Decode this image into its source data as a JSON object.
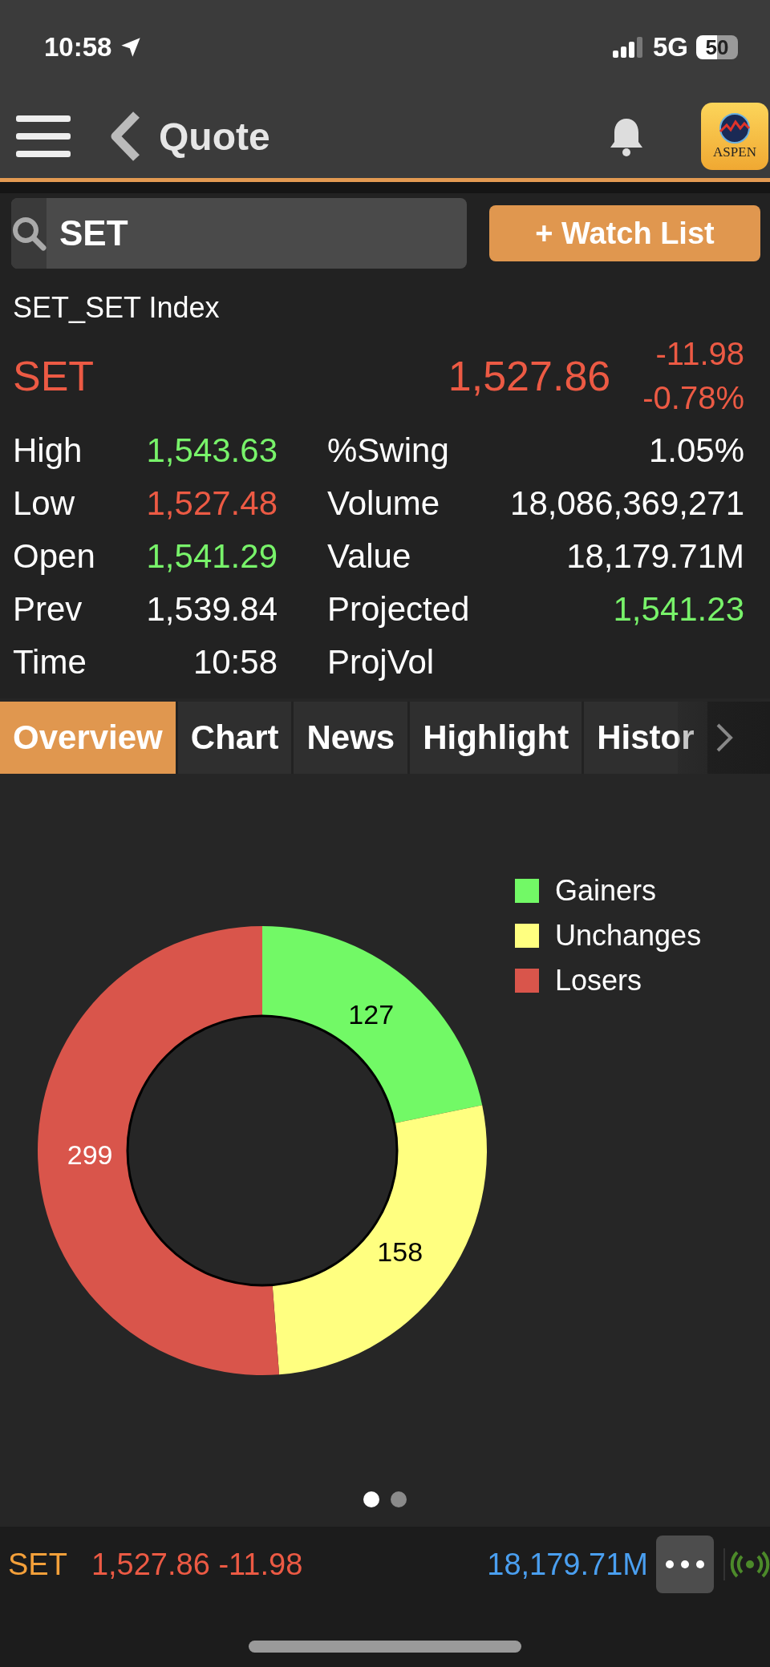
{
  "status_bar": {
    "time": "10:58",
    "network": "5G",
    "battery": "50"
  },
  "nav": {
    "title": "Quote",
    "logo": "ASPEN"
  },
  "search": {
    "value": "SET"
  },
  "watch_button": "+ Watch List",
  "quote": {
    "name": "SET_SET Index",
    "symbol": "SET",
    "price": "1,527.86",
    "change": "-11.98",
    "change_pct": "-0.78%",
    "rising": false,
    "falling": true
  },
  "stats": [
    {
      "label": "High",
      "value": "1,543.63",
      "rising": true,
      "falling": false,
      "label_2": "%Swing",
      "value_2": "1.05%",
      "rising_2": false,
      "falling_2": false
    },
    {
      "label": "Low",
      "value": "1,527.48",
      "rising": false,
      "falling": true,
      "label_2": "Volume",
      "value_2": "18,086,369,271",
      "rising_2": false,
      "falling_2": false
    },
    {
      "label": "Open",
      "value": "1,541.29",
      "rising": true,
      "falling": false,
      "label_2": "Value",
      "value_2": "18,179.71M",
      "rising_2": false,
      "falling_2": false
    },
    {
      "label": "Prev",
      "value": "1,539.84",
      "rising": false,
      "falling": false,
      "label_2": "Projected",
      "value_2": "1,541.23",
      "rising_2": true,
      "falling_2": false
    },
    {
      "label": "Time",
      "value": "10:58",
      "rising": false,
      "falling": false,
      "label_2": "ProjVol"
    }
  ],
  "tabs": [
    {
      "label": "Overview",
      "selected": true
    },
    {
      "label": "Chart",
      "selected": false
    },
    {
      "label": "News",
      "selected": false
    },
    {
      "label": "Highlight",
      "selected": false
    },
    {
      "label": "Histor",
      "selected": false
    }
  ],
  "chart_data": {
    "type": "donut",
    "categories": [
      "Gainers",
      "Unchanges",
      "Losers"
    ],
    "values": [
      127,
      158,
      299
    ],
    "colors": [
      "#72f966",
      "#ffff80",
      "#d9554b"
    ],
    "data_labels": true
  },
  "pages": [
    {
      "selected": true
    },
    {
      "selected": false
    }
  ],
  "ticker": {
    "symbol": "SET",
    "price_change": "1,527.86 -11.98",
    "value": "18,179.71M"
  }
}
